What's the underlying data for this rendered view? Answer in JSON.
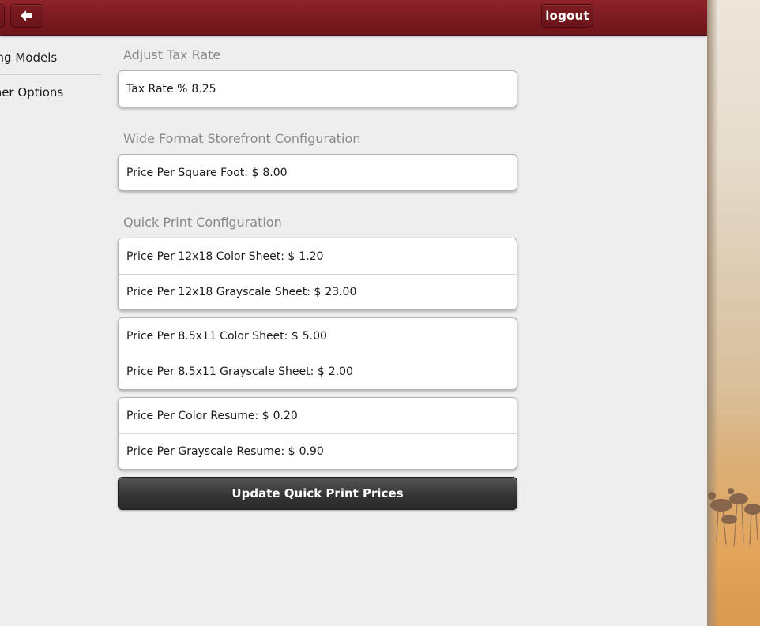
{
  "topbar": {
    "back_icon": "arrow-left-icon",
    "logout_label": "logout"
  },
  "sidebar": {
    "items": [
      {
        "label": "Pricing Models"
      },
      {
        "label": "Other Options"
      }
    ]
  },
  "sections": {
    "tax": {
      "title": "Adjust Tax Rate",
      "label": "Tax Rate %",
      "value": "8.25"
    },
    "wide_format": {
      "title": "Wide Format Storefront Configuration",
      "label": "Price Per Square Foot: $",
      "value": "8.00"
    },
    "quick_print": {
      "title": "Quick Print Configuration",
      "rows": [
        {
          "label": "Price Per 12x18 Color Sheet: $",
          "value": "1.20"
        },
        {
          "label": "Price Per 12x18 Grayscale Sheet: $",
          "value": "23.00"
        },
        {
          "label": "Price Per 8.5x11 Color Sheet: $",
          "value": "5.00"
        },
        {
          "label": "Price Per 8.5x11 Grayscale Sheet: $",
          "value": "2.00"
        },
        {
          "label": "Price Per Color Resume: $",
          "value": "0.20"
        },
        {
          "label": "Price Per Grayscale Resume: $",
          "value": "0.90"
        }
      ],
      "button_label": "Update Quick Print Prices"
    }
  },
  "colors": {
    "topbar": "#7a1a20",
    "button_dark": "#333333",
    "section_title": "#8a8a8a"
  }
}
